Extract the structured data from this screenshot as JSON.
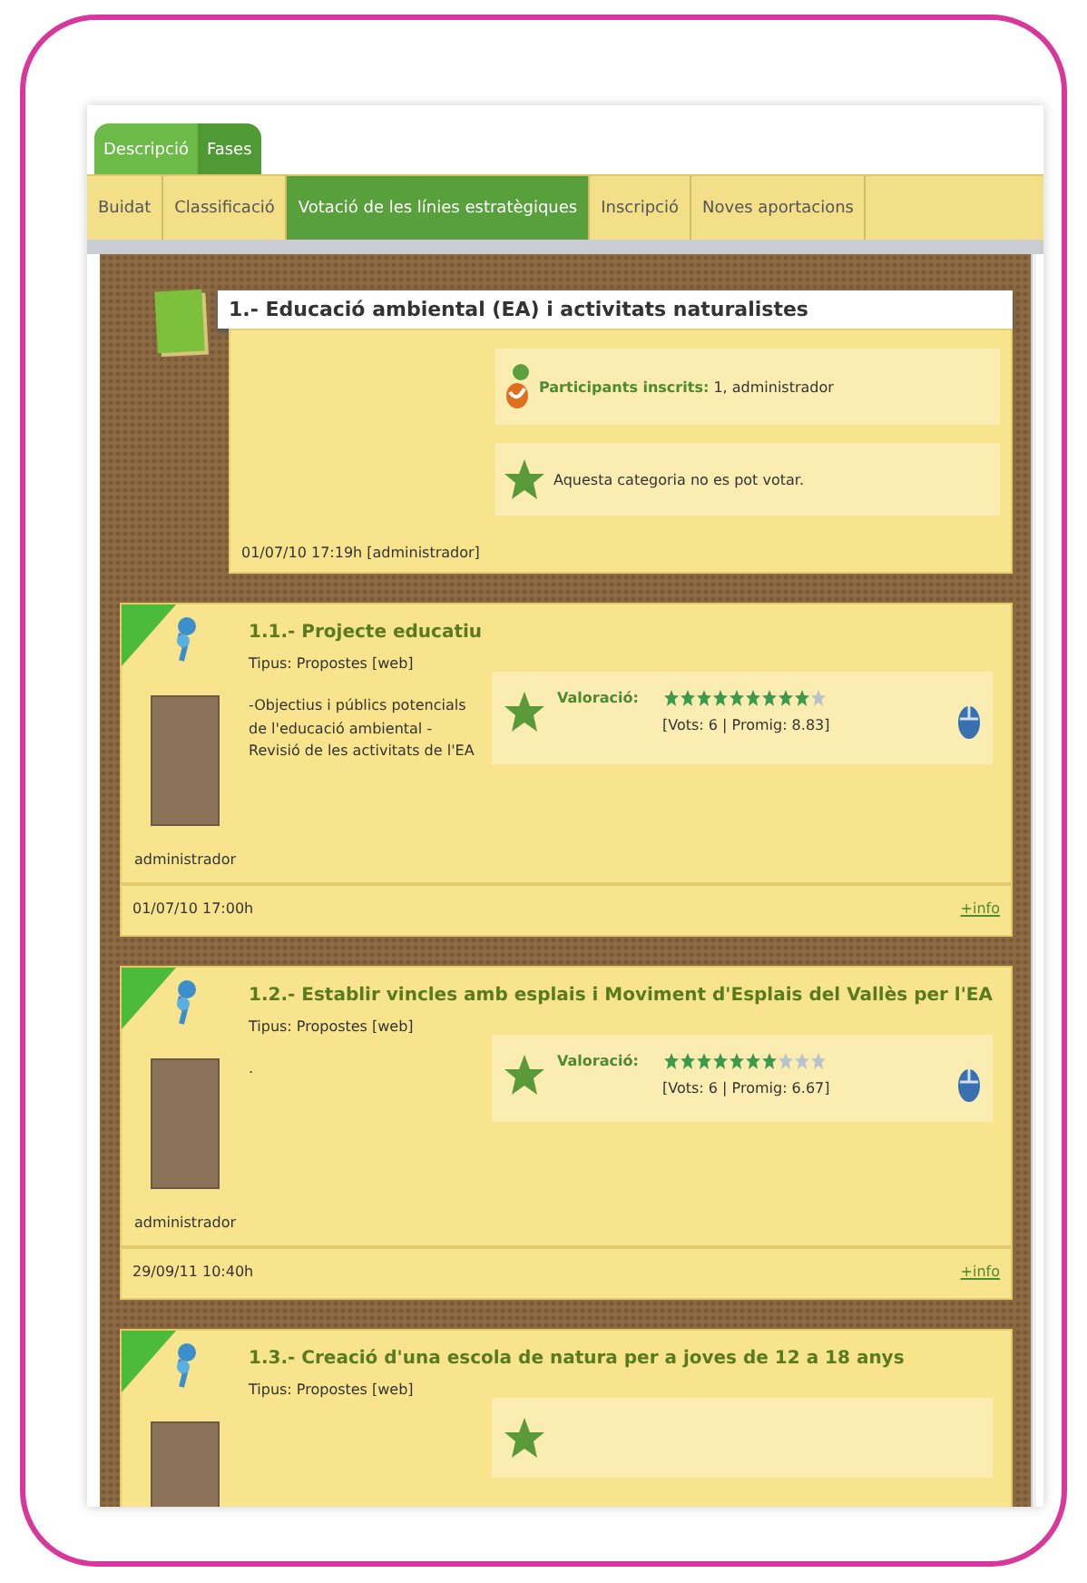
{
  "top_tabs": [
    {
      "label": "Descripció",
      "selected": false
    },
    {
      "label": "Fases",
      "selected": true
    }
  ],
  "phase_tabs": [
    {
      "label": "Buidat",
      "selected": false
    },
    {
      "label": "Classificació",
      "selected": false
    },
    {
      "label": "Votació de les línies estratègiques",
      "selected": true
    },
    {
      "label": "Inscripció",
      "selected": false
    },
    {
      "label": "Noves aportacions",
      "selected": false
    }
  ],
  "category": {
    "title": "1.- Educació ambiental (EA) i activitats naturalistes",
    "participants_label": "Participants inscrits:",
    "participants": "1, administrador",
    "vote_note": "Aquesta categoria no es pot votar.",
    "footer": "01/07/10 17:19h [administrador]"
  },
  "proposals": [
    {
      "title": "1.1.- Projecte educatiu",
      "type": "Tipus: Propostes [web]",
      "description": "-Objectius i públics potencials de l'educació ambiental - Revisió de les activitats de l'EA",
      "author": "administrador",
      "rating_label": "Valoració:",
      "stars": 9,
      "votes": "[Vots: 6 | Promig: 8.83]",
      "date": "01/07/10 17:00h",
      "link": "+info"
    },
    {
      "title": "1.2.- Establir vincles amb esplais i Moviment d'Esplais del Vallès per l'EA",
      "type": "Tipus: Propostes [web]",
      "description": ".",
      "author": "administrador",
      "rating_label": "Valoració:",
      "stars": 7,
      "votes": "[Vots: 6 | Promig: 6.67]",
      "date": "29/09/11 10:40h",
      "link": "+info"
    },
    {
      "title": "1.3.- Creació d'una escola de natura per a joves de 12 a 18 anys",
      "type": "Tipus: Propostes [web]"
    }
  ]
}
